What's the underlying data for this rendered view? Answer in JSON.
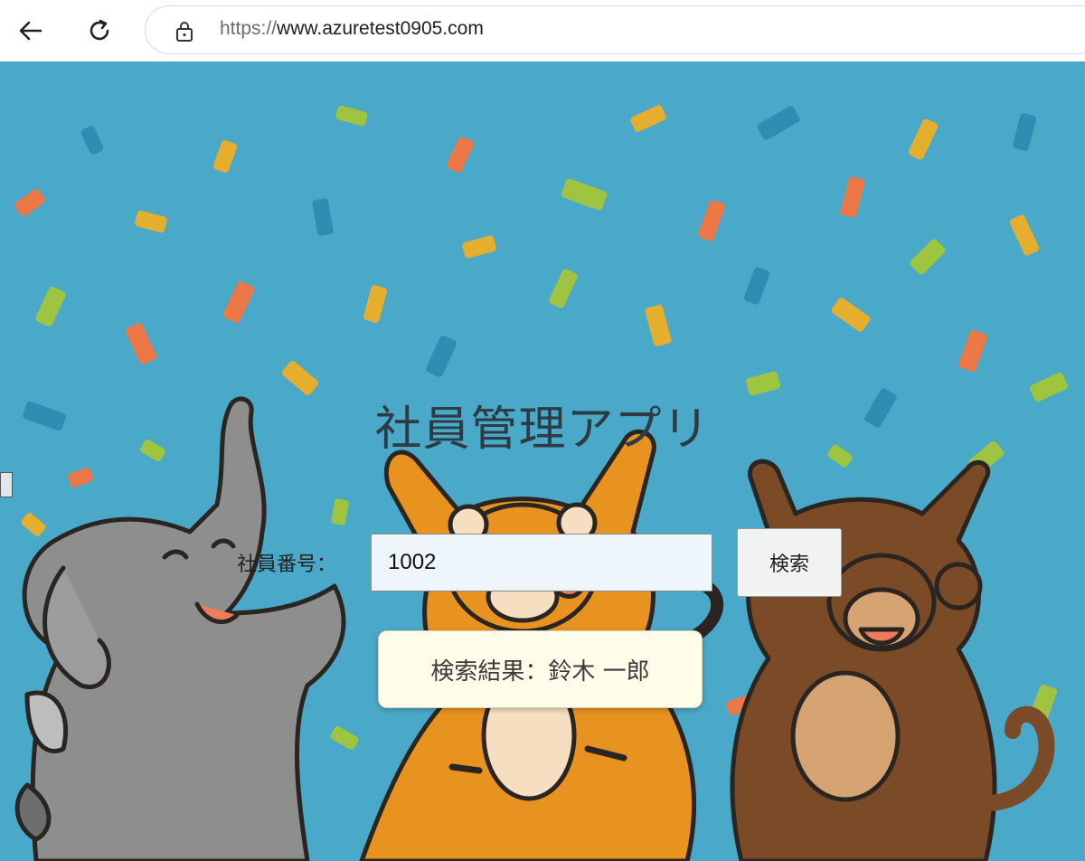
{
  "browser": {
    "url_scheme": "https://",
    "url_host": "www.azuretest0905.com",
    "icons": [
      "back-arrow-icon",
      "reload-icon",
      "lock-icon"
    ]
  },
  "page": {
    "title": "社員管理アプリ",
    "employee_number_label": "社員番号：",
    "employee_number_value": "1002",
    "search_button_label": "検索",
    "result_text": "検索結果：鈴木 一郎"
  },
  "colors": {
    "background": "#4aa8c8",
    "title": "#2e3b45",
    "input_background": "#eef5fb",
    "result_background": "#fffde9",
    "elephant": "#8e8e8e",
    "tiger": "#e8931f",
    "monkey": "#7b4a26"
  }
}
